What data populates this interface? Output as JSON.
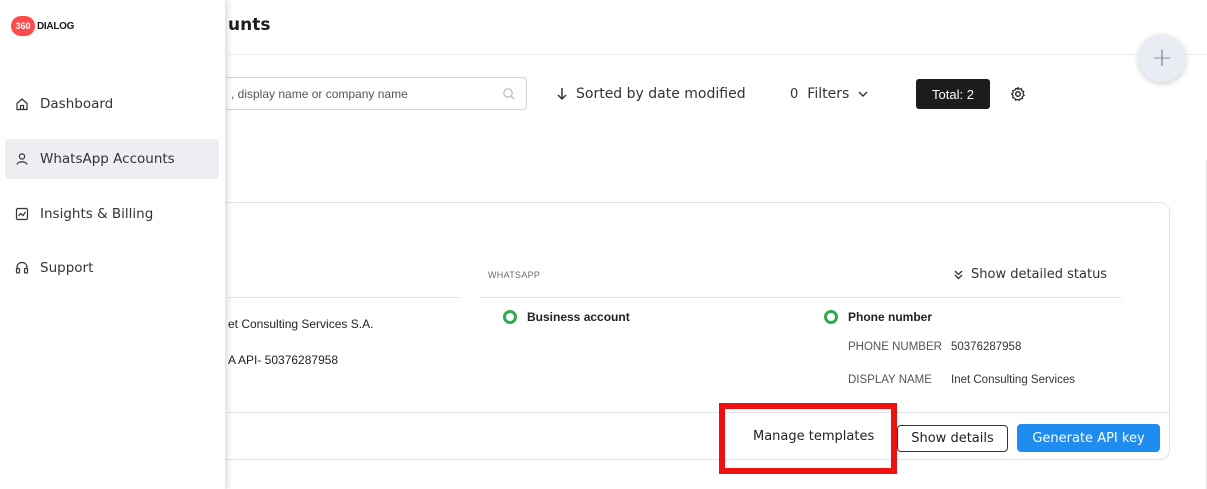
{
  "app": {
    "logo_badge": "360",
    "logo_text": "DIALOG"
  },
  "sidebar": {
    "items": [
      {
        "label": "Dashboard",
        "icon": "home-icon",
        "active": false
      },
      {
        "label": "WhatsApp Accounts",
        "icon": "user-icon",
        "active": true
      },
      {
        "label": "Insights & Billing",
        "icon": "chart-icon",
        "active": false
      },
      {
        "label": "Support",
        "icon": "headset-icon",
        "active": false
      }
    ]
  },
  "header": {
    "title": "unts",
    "fab_label": "+"
  },
  "toolbar": {
    "search_placeholder": ", display name or company name",
    "sort_label": "Sorted by date modified",
    "filters_count": "0",
    "filters_label": "Filters",
    "total_label": "Total: 2"
  },
  "card": {
    "section_label": "WHATSAPP",
    "detail_toggle": "Show detailed status",
    "client_name": "et Consulting Services S.A.",
    "channel_name": "A API- 50376287958",
    "business_account_label": "Business account",
    "phone_label": "Phone number",
    "phone_number_key": "PHONE NUMBER",
    "phone_number_value": "50376287958",
    "display_name_key": "DISPLAY NAME",
    "display_name_value": "Inet Consulting Services",
    "status_color": "#2eaa4f",
    "buttons": {
      "manage_templates": "Manage templates",
      "show_details": "Show details",
      "generate_api_key": "Generate API key"
    }
  },
  "colors": {
    "accent": "#1f8cf0",
    "brand": "#ff4b4b",
    "highlight": "#ee1111"
  }
}
